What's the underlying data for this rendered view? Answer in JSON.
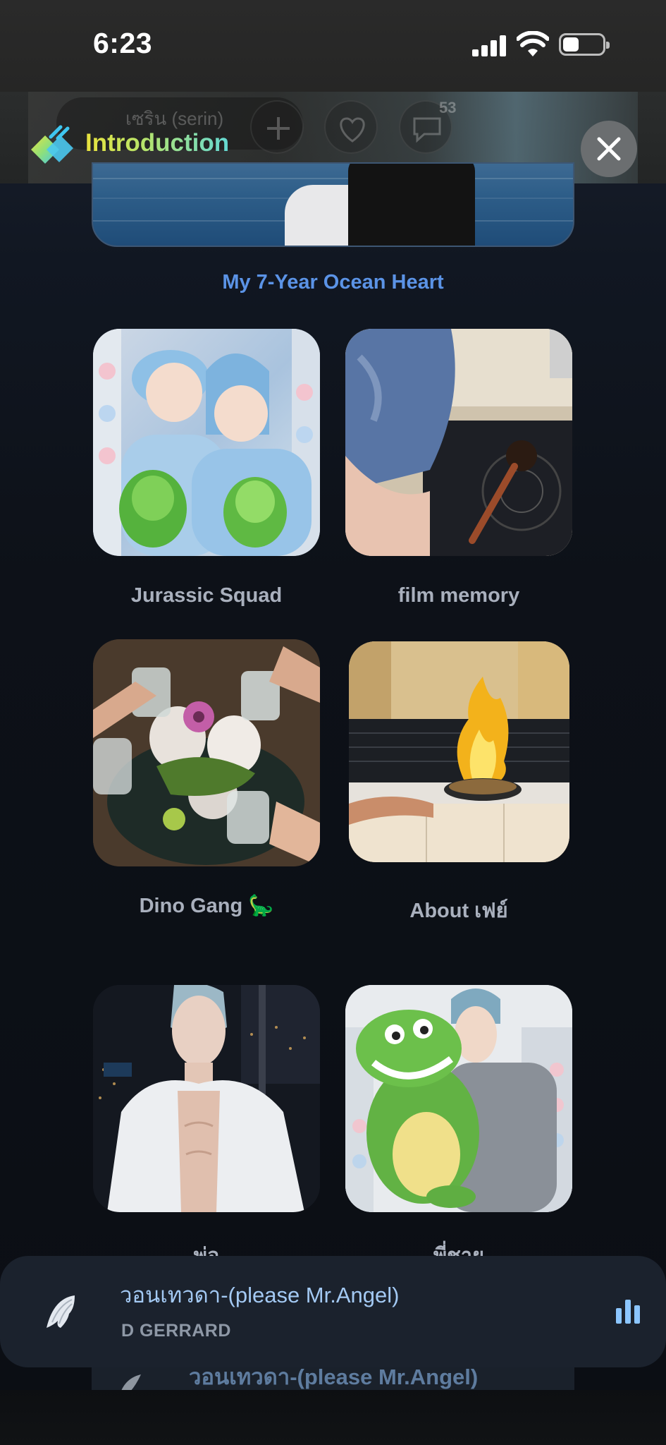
{
  "status_bar": {
    "time": "6:23"
  },
  "header": {
    "title": "Introduction",
    "behind_name": "เซริน (serin)",
    "behind_comment_count": "53"
  },
  "section": {
    "title": "My 7-Year Ocean Heart"
  },
  "tiles": [
    {
      "label": "Jurassic Squad"
    },
    {
      "label": "film memory"
    },
    {
      "label": "Dino Gang 🦕"
    },
    {
      "label": "About เฟย์"
    },
    {
      "label": "พ่อ"
    },
    {
      "label": "พี่ชาย"
    }
  ],
  "player": {
    "song": "วอนเทวดา-(please Mr.Angel)",
    "artist": "D GERRARD",
    "behind_song": "วอนเทวดา-(please Mr.Angel)"
  },
  "colors": {
    "accent_blue": "#5b93e6",
    "song_color": "#a3c9f3",
    "eq_color": "#8cc6ff"
  }
}
